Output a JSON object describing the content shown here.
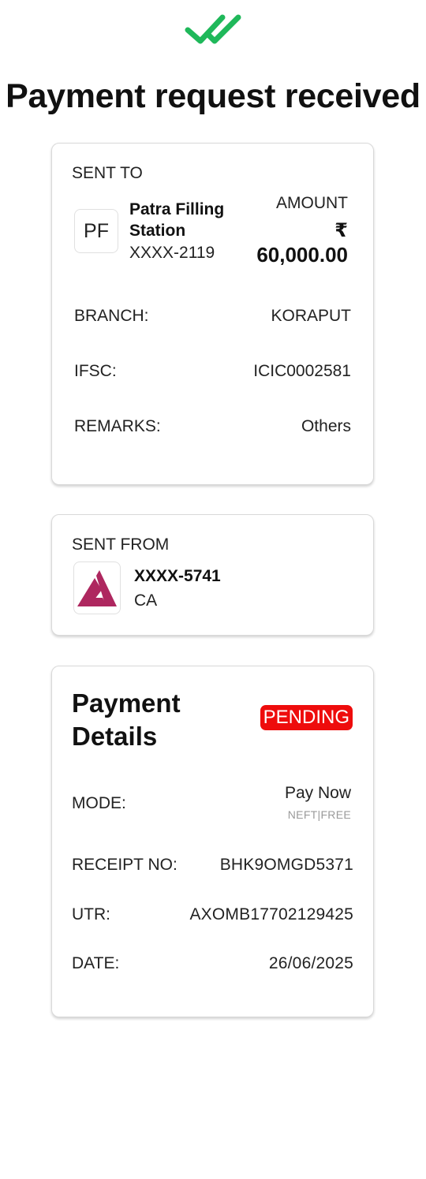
{
  "colors": {
    "accent_green": "#1fb85a",
    "pending_red": "#ee0c0c",
    "axis_brand": "#ae275f"
  },
  "header": {
    "icon": "double-check-icon",
    "title": "Payment request received"
  },
  "sent_to": {
    "section_label": "SENT TO",
    "avatar_initials": "PF",
    "payee_name": "Patra Filling Station",
    "account": "XXXX-2119",
    "amount_label": "AMOUNT",
    "currency_symbol": "₹",
    "amount": "60,000.00",
    "rows": [
      {
        "label": "BRANCH:",
        "value": "KORAPUT"
      },
      {
        "label": "IFSC:",
        "value": "ICIC0002581"
      },
      {
        "label": "REMARKS:",
        "value": "Others"
      }
    ]
  },
  "sent_from": {
    "section_label": "SENT FROM",
    "bank_logo": "axis-bank-logo",
    "account": "XXXX-5741",
    "account_type": "CA"
  },
  "payment_details": {
    "title": "Payment Details",
    "status": "PENDING",
    "mode_label": "MODE:",
    "mode_value": "Pay Now",
    "mode_sub": "NEFT|FREE",
    "rows": [
      {
        "label": "RECEIPT NO:",
        "value": "BHK9OMGD5371"
      },
      {
        "label": "UTR:",
        "value": "AXOMB17702129425"
      },
      {
        "label": "DATE:",
        "value": "26/06/2025"
      }
    ]
  }
}
